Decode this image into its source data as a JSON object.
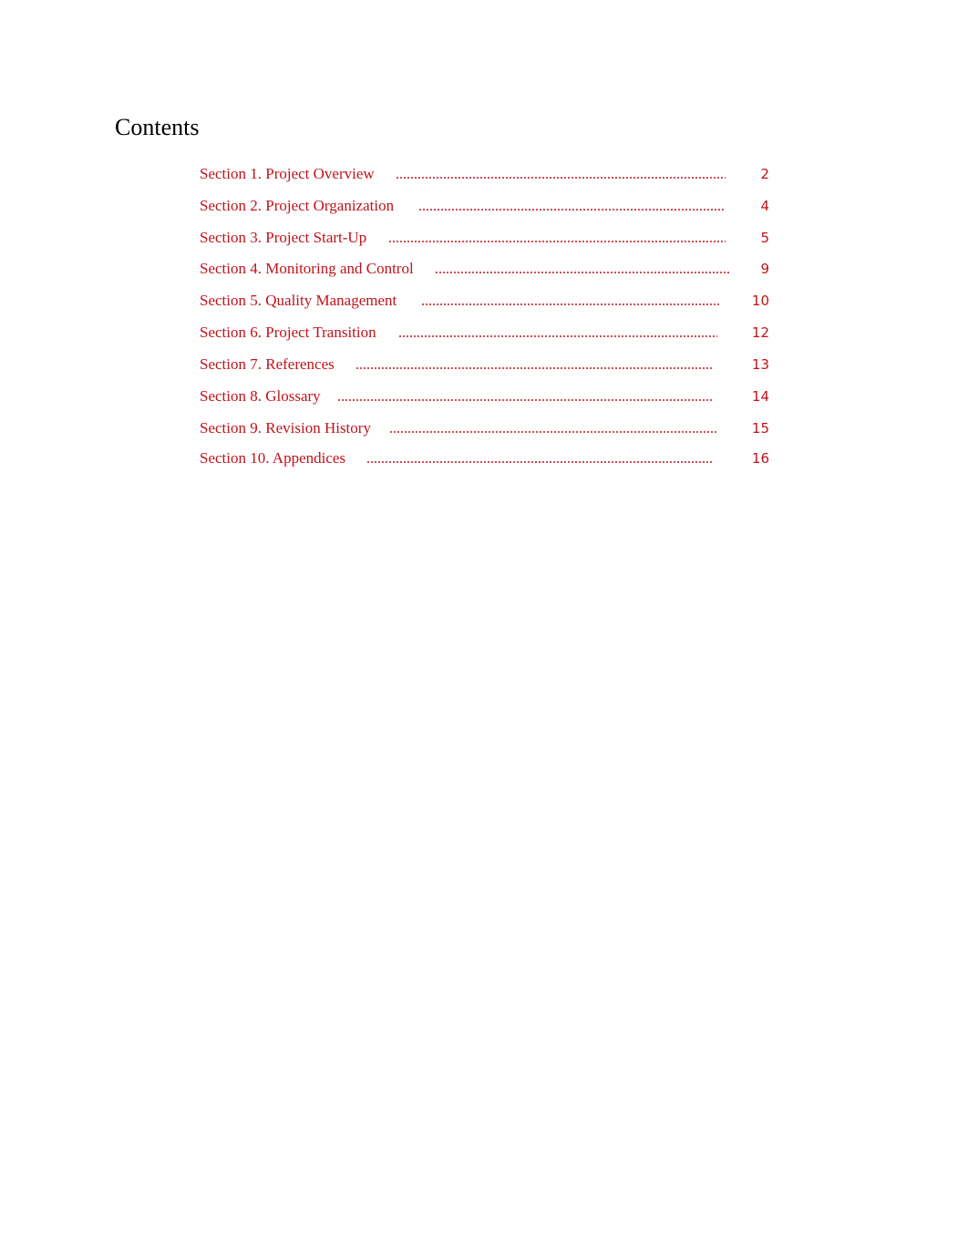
{
  "document": {
    "title": "Contents",
    "link_color": "#c0131a",
    "toc": [
      {
        "label": "Section 1. Project Overview",
        "page": "2"
      },
      {
        "label": "Section 2. Project Organization",
        "page": "4"
      },
      {
        "label": "Section 3. Project Start-Up",
        "page": "5"
      },
      {
        "label": "Section 4. Monitoring and Control",
        "page": "9"
      },
      {
        "label": "Section 5. Quality Management",
        "page": "10"
      },
      {
        "label": "Section 6. Project Transition",
        "page": "12"
      },
      {
        "label": "Section 7. References",
        "page": "13"
      },
      {
        "label": "Section 8. Glossary",
        "page": "14"
      },
      {
        "label": "Section 9. Revision History",
        "page": "15"
      },
      {
        "label": "Section 10. Appendices",
        "page": "16"
      }
    ]
  }
}
